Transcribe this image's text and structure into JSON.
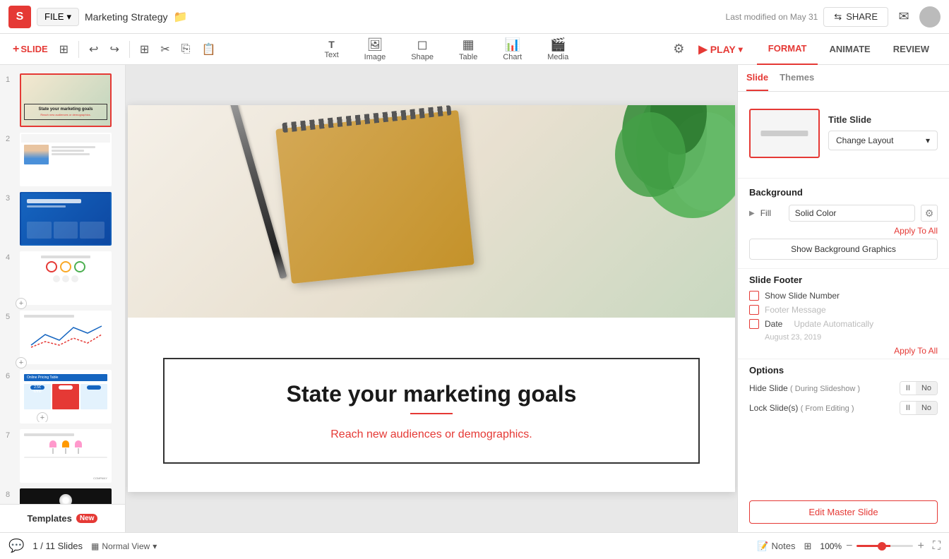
{
  "app": {
    "logo": "S",
    "file_label": "FILE",
    "doc_title": "Marketing Strategy",
    "last_modified": "Last modified on May 31",
    "share_label": "SHARE"
  },
  "toolbar": {
    "add_slide": "SLIDE",
    "undo_title": "Undo",
    "redo_title": "Redo",
    "insert_tools": [
      {
        "label": "Text",
        "icon": "T"
      },
      {
        "label": "Image",
        "icon": "🖼"
      },
      {
        "label": "Shape",
        "icon": "◻"
      },
      {
        "label": "Table",
        "icon": "▦"
      },
      {
        "label": "Chart",
        "icon": "📊"
      },
      {
        "label": "Media",
        "icon": "▶"
      }
    ],
    "play_label": "PLAY",
    "format_label": "FORMAT",
    "animate_label": "ANIMATE",
    "review_label": "REVIEW"
  },
  "slide_panel": {
    "slides": [
      {
        "number": "1",
        "type": "title"
      },
      {
        "number": "2",
        "type": "content"
      },
      {
        "number": "3",
        "type": "blue"
      },
      {
        "number": "4",
        "type": "circles"
      },
      {
        "number": "5",
        "type": "chart"
      },
      {
        "number": "6",
        "type": "pricing"
      },
      {
        "number": "7",
        "type": "map"
      },
      {
        "number": "8",
        "type": "dark"
      }
    ],
    "templates_label": "Templates",
    "new_badge": "New"
  },
  "slide": {
    "title": "State your marketing goals",
    "subtitle": "Reach new audiences or demographics."
  },
  "right_panel": {
    "tabs": [
      {
        "label": "Slide",
        "active": true
      },
      {
        "label": "Themes",
        "active": false
      }
    ],
    "layout": {
      "name": "Title Slide",
      "change_layout_label": "Change Layout"
    },
    "background": {
      "section_title": "Background",
      "fill_label": "Fill",
      "fill_type": "Solid Color",
      "apply_to_all": "Apply To All",
      "show_bg_graphics": "Show Background Graphics"
    },
    "footer": {
      "section_title": "Slide Footer",
      "show_slide_number": "Show Slide Number",
      "footer_message": "Footer Message",
      "date_label": "Date",
      "date_placeholder": "Update Automatically",
      "date_sub": "August 23, 2019",
      "apply_to_all": "Apply To All"
    },
    "options": {
      "section_title": "Options",
      "hide_slide_label": "Hide Slide",
      "hide_slide_sub": "( During Slideshow )",
      "lock_slide_label": "Lock Slide(s)",
      "lock_slide_sub": "( From Editing )",
      "toggle_ii": "II",
      "toggle_no": "No"
    },
    "edit_master_label": "Edit Master Slide",
    "apply_to_ai": "Apply To AI"
  },
  "bottom_bar": {
    "page_current": "1",
    "page_total": "11 Slides",
    "view_label": "Normal View",
    "notes_label": "Notes",
    "zoom_level": "100%"
  }
}
